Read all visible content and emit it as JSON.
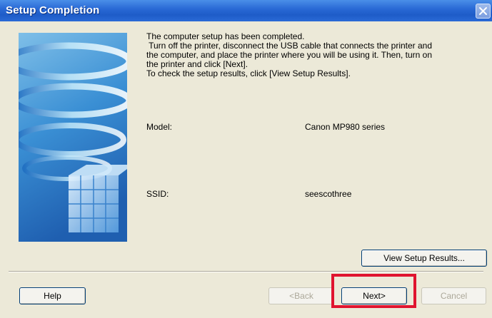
{
  "window": {
    "title": "Setup Completion"
  },
  "message": {
    "lines": [
      "The computer setup has been completed.",
      " Turn off the printer, disconnect the USB cable that connects the printer and",
      "the computer, and place the printer where you will be using it. Then, turn on",
      "the printer and click [Next].",
      "To check the setup results, click [View Setup Results]."
    ]
  },
  "fields": {
    "model_label": "Model:",
    "model_value": "Canon MP980 series",
    "ssid_label": "SSID:",
    "ssid_value": "seescothree"
  },
  "buttons": {
    "view_results": "View Setup Results...",
    "help": "Help",
    "back": "<Back",
    "next": "Next>",
    "cancel": "Cancel"
  },
  "colors": {
    "title_bar": "#2a6ad6",
    "dialog_background": "#ece9d8",
    "highlight_box": "#e0142f"
  }
}
